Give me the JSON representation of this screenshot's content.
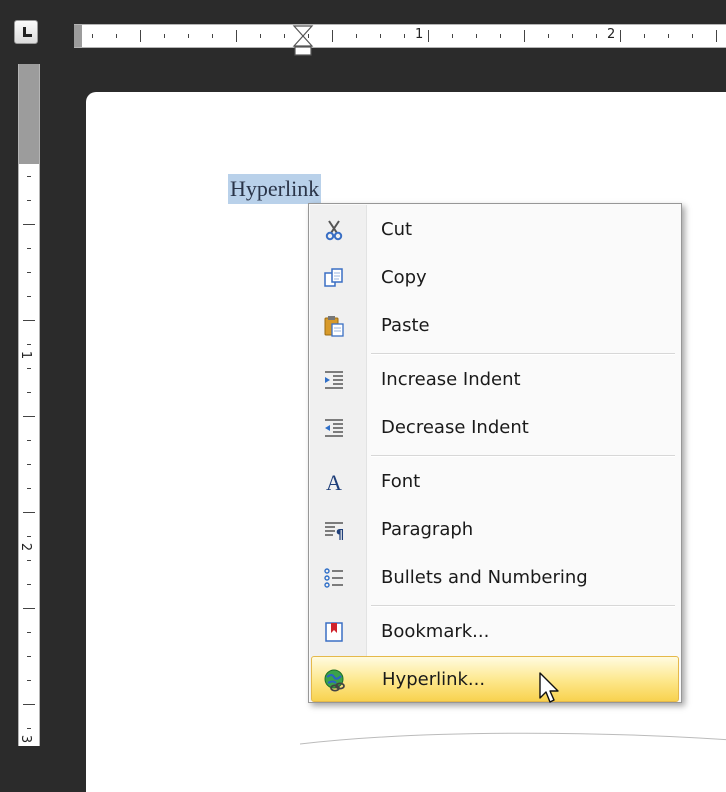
{
  "ruler": {
    "horizontal_numbers": [
      "1",
      "2"
    ],
    "vertical_numbers": [
      "1",
      "2",
      "3"
    ]
  },
  "document": {
    "selected_text": "Hyperlink"
  },
  "context_menu": {
    "items": [
      {
        "label": "Cut",
        "icon": "scissors-icon"
      },
      {
        "label": "Copy",
        "icon": "copy-icon"
      },
      {
        "label": "Paste",
        "icon": "paste-icon"
      },
      {
        "label": "Increase Indent",
        "icon": "increase-indent-icon"
      },
      {
        "label": "Decrease Indent",
        "icon": "decrease-indent-icon"
      },
      {
        "label": "Font",
        "icon": "font-icon"
      },
      {
        "label": "Paragraph",
        "icon": "paragraph-icon"
      },
      {
        "label": "Bullets and Numbering",
        "icon": "bullets-numbering-icon"
      },
      {
        "label": "Bookmark...",
        "icon": "bookmark-icon"
      },
      {
        "label": "Hyperlink...",
        "icon": "hyperlink-icon",
        "highlighted": true
      }
    ]
  },
  "colors": {
    "selection": "#b9d1ea",
    "menu_highlight": "#fde78a",
    "chrome_background": "#2b2b2b"
  }
}
